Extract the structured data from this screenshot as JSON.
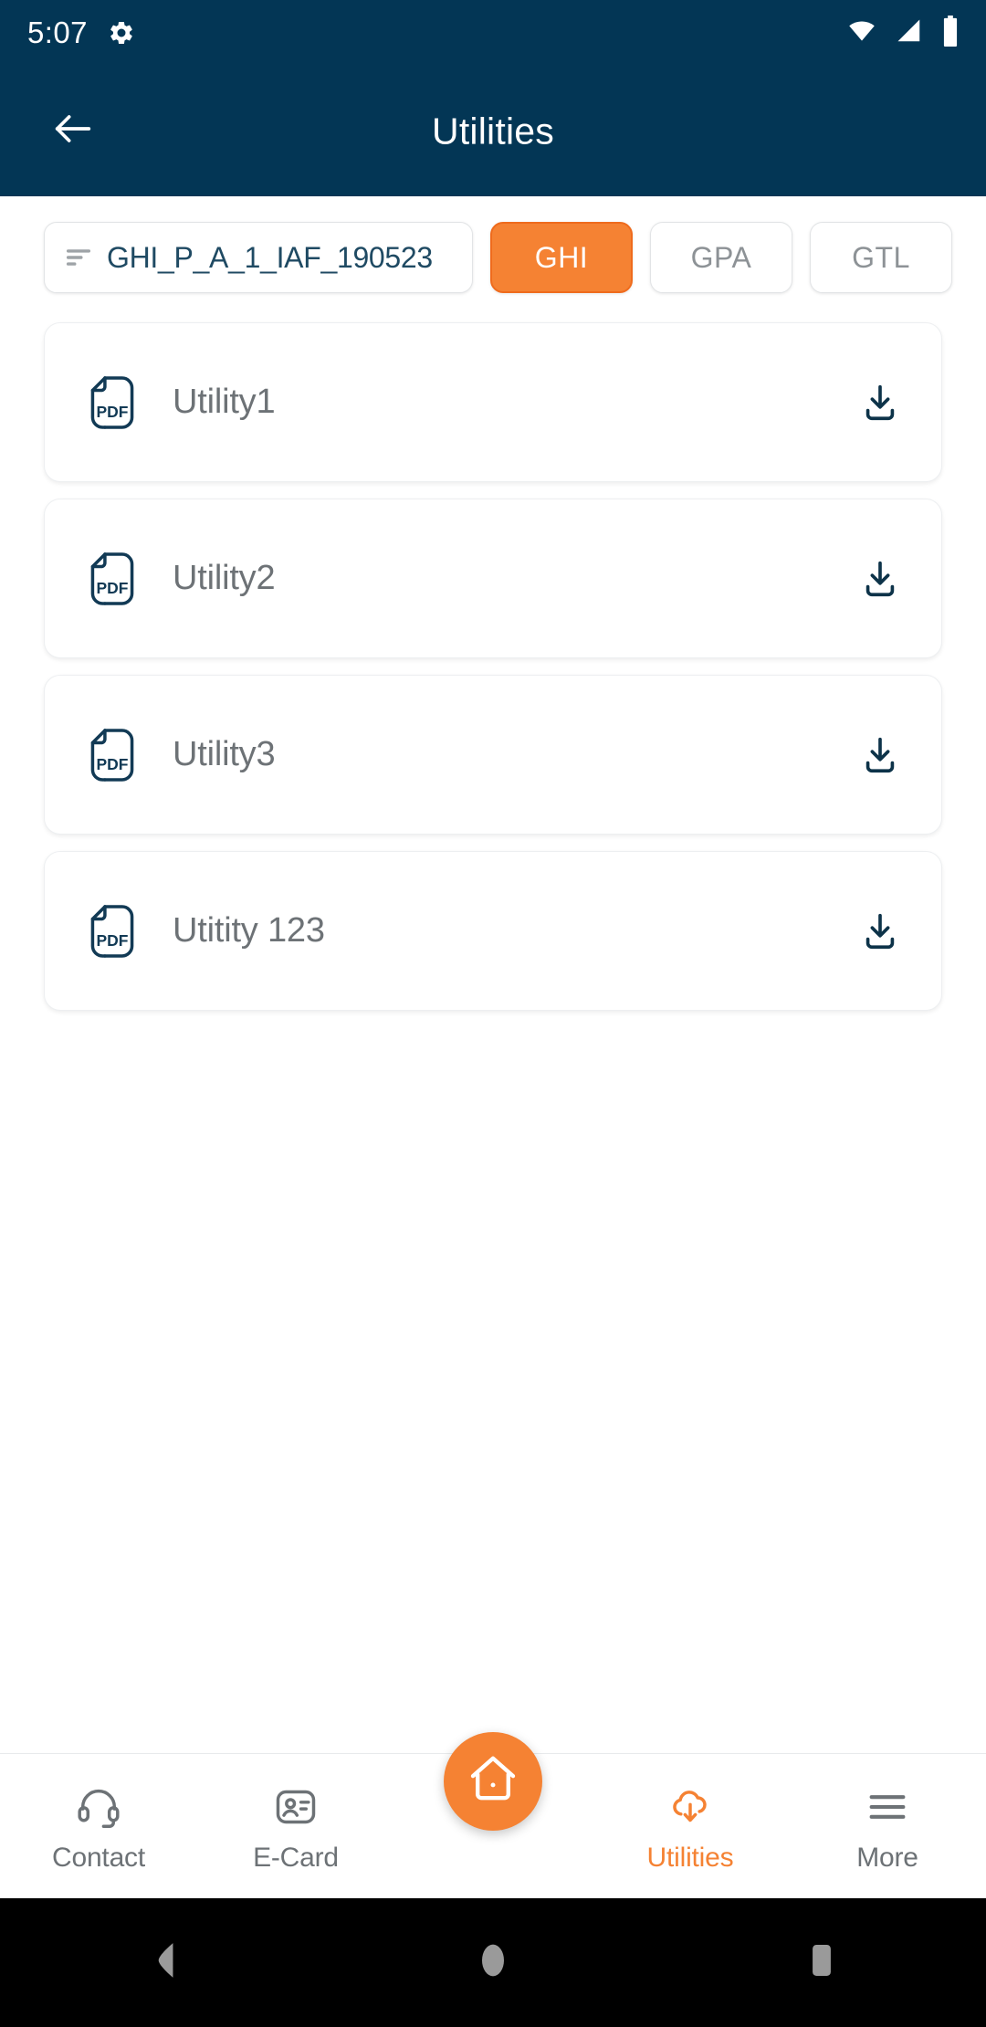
{
  "status_bar": {
    "time": "5:07",
    "gear_icon": "gear-icon",
    "wifi_icon": "wifi-icon",
    "signal_icon": "cellular-signal-icon",
    "battery_icon": "battery-icon",
    "background_color": "#033655"
  },
  "app_bar": {
    "back_icon": "back-arrow-icon",
    "title": "Utilities",
    "background_color": "#033655",
    "text_color": "#ffffff"
  },
  "filters": {
    "field": {
      "icon": "filter-sort-icon",
      "value": "GHI_P_A_1_IAF_190523"
    },
    "chips": [
      {
        "label": "GHI",
        "active": true
      },
      {
        "label": "GPA",
        "active": false
      },
      {
        "label": "GTL",
        "active": false
      }
    ],
    "active_color": "#f58233",
    "inactive_text_color": "#8d9296"
  },
  "documents": [
    {
      "icon": "pdf-file-icon",
      "name": "Utility1",
      "action_icon": "download-icon"
    },
    {
      "icon": "pdf-file-icon",
      "name": "Utility2",
      "action_icon": "download-icon"
    },
    {
      "icon": "pdf-file-icon",
      "name": "Utility3",
      "action_icon": "download-icon"
    },
    {
      "icon": "pdf-file-icon",
      "name": "Utitity 123",
      "action_icon": "download-icon"
    }
  ],
  "bottom_nav": {
    "items": [
      {
        "label": "Contact",
        "icon": "headset-icon",
        "active": false
      },
      {
        "label": "E-Card",
        "icon": "id-card-icon",
        "active": false
      },
      {
        "label": "Utilities",
        "icon": "cloud-download-icon",
        "active": true
      },
      {
        "label": "More",
        "icon": "hamburger-menu-icon",
        "active": false
      }
    ],
    "fab": {
      "icon": "home-icon",
      "color": "#f58233"
    },
    "active_color": "#f58233",
    "inactive_color": "#6d7276"
  },
  "android_nav": {
    "back": "android-back-icon",
    "home": "android-home-icon",
    "recents": "android-recents-icon"
  }
}
